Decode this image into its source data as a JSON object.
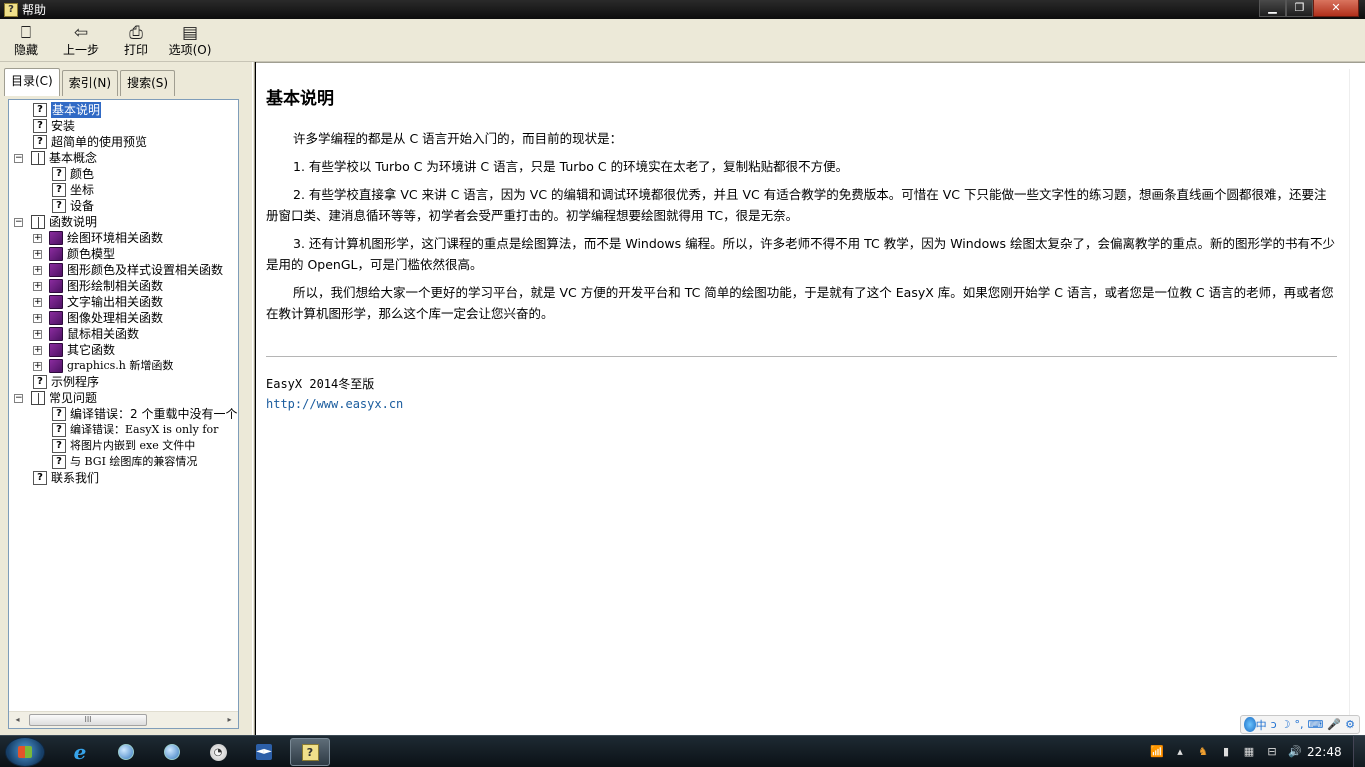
{
  "window": {
    "title": "帮助",
    "min": "▁",
    "max": "❐",
    "close": "✕"
  },
  "toolbar": [
    {
      "label": "隐藏",
      "icon": "hide-icon",
      "glyph": "⎕"
    },
    {
      "label": "上一步",
      "icon": "back-arrow-icon",
      "glyph": "⇦"
    },
    {
      "label": "打印",
      "icon": "printer-icon",
      "glyph": "⎙"
    },
    {
      "label": "选项(O)",
      "icon": "options-icon",
      "glyph": "▤"
    }
  ],
  "tabs": [
    "目录(C)",
    "索引(N)",
    "搜索(S)"
  ],
  "tree": [
    {
      "label": "基本说明",
      "icon": "q",
      "selected": true
    },
    {
      "label": "安装",
      "icon": "q"
    },
    {
      "label": "超简单的使用预览",
      "icon": "q"
    },
    {
      "label": "基本概念",
      "icon": "open",
      "expander": "−"
    },
    {
      "label": "颜色",
      "icon": "q"
    },
    {
      "label": "坐标",
      "icon": "q"
    },
    {
      "label": "设备",
      "icon": "q"
    },
    {
      "label": "函数说明",
      "icon": "open",
      "expander": "−"
    },
    {
      "label": "绘图环境相关函数",
      "icon": "book",
      "expander": "+"
    },
    {
      "label": "颜色模型",
      "icon": "book",
      "expander": "+"
    },
    {
      "label": "图形颜色及样式设置相关函数",
      "icon": "book",
      "expander": "+"
    },
    {
      "label": "图形绘制相关函数",
      "icon": "book",
      "expander": "+"
    },
    {
      "label": "文字输出相关函数",
      "icon": "book",
      "expander": "+"
    },
    {
      "label": "图像处理相关函数",
      "icon": "book",
      "expander": "+"
    },
    {
      "label": "鼠标相关函数",
      "icon": "book",
      "expander": "+"
    },
    {
      "label": "其它函数",
      "icon": "book",
      "expander": "+"
    },
    {
      "label": "graphics.h 新增函数",
      "icon": "book",
      "expander": "+"
    },
    {
      "label": "示例程序",
      "icon": "q"
    },
    {
      "label": "常见问题",
      "icon": "open",
      "expander": "−"
    },
    {
      "label": "编译错误：2 个重载中没有一个",
      "icon": "q"
    },
    {
      "label": "编译错误：EasyX is only for",
      "icon": "q"
    },
    {
      "label": "将图片内嵌到 exe 文件中",
      "icon": "q"
    },
    {
      "label": "与 BGI 绘图库的兼容情况",
      "icon": "q"
    },
    {
      "label": "联系我们",
      "icon": "q"
    }
  ],
  "scroll": {
    "left_arrow": "◂",
    "right_arrow": "▸",
    "thumb": "III"
  },
  "doc": {
    "heading": "基本说明",
    "paragraphs": [
      "许多学编程的都是从 C 语言开始入门的，而目前的现状是：",
      "1. 有些学校以 Turbo C 为环境讲 C 语言，只是 Turbo C 的环境实在太老了，复制粘贴都很不方便。",
      "2. 有些学校直接拿 VC 来讲 C 语言，因为 VC 的编辑和调试环境都很优秀，并且 VC 有适合教学的免费版本。可惜在 VC 下只能做一些文字性的练习题，想画条直线画个圆都很难，还要注册窗口类、建消息循环等等，初学者会受严重打击的。初学编程想要绘图就得用 TC，很是无奈。",
      "3. 还有计算机图形学，这门课程的重点是绘图算法，而不是 Windows 编程。所以，许多老师不得不用 TC 教学，因为 Windows 绘图太复杂了，会偏离教学的重点。新的图形学的书有不少是用的 OpenGL，可是门槛依然很高。",
      "所以，我们想给大家一个更好的学习平台，就是 VC 方便的开发平台和 TC 简单的绘图功能，于是就有了这个 EasyX 库。如果您刚开始学 C 语言，或者您是一位教 C 语言的老师，再或者您在教计算机图形学，那么这个库一定会让您兴奋的。"
    ],
    "version": "EasyX 2014冬至版",
    "url": "http://www.easyx.cn"
  },
  "ime": {
    "items": [
      "中",
      "ↄ",
      "☽",
      "°,",
      "⌨",
      "🎤",
      "⚙"
    ]
  },
  "taskbar": {
    "items": [
      {
        "name": "taskbar-ie",
        "glyph": "e"
      },
      {
        "name": "taskbar-browser",
        "glyph": ""
      },
      {
        "name": "taskbar-app-globe",
        "glyph": ""
      },
      {
        "name": "taskbar-app-white",
        "glyph": "◔"
      },
      {
        "name": "taskbar-visual-studio",
        "glyph": "◄►"
      },
      {
        "name": "taskbar-help-window",
        "glyph": "?"
      }
    ],
    "tray": [
      "📶",
      "▴",
      "♞",
      "▮",
      "▦",
      "⊟",
      "🔊"
    ],
    "clock": "22:48"
  }
}
